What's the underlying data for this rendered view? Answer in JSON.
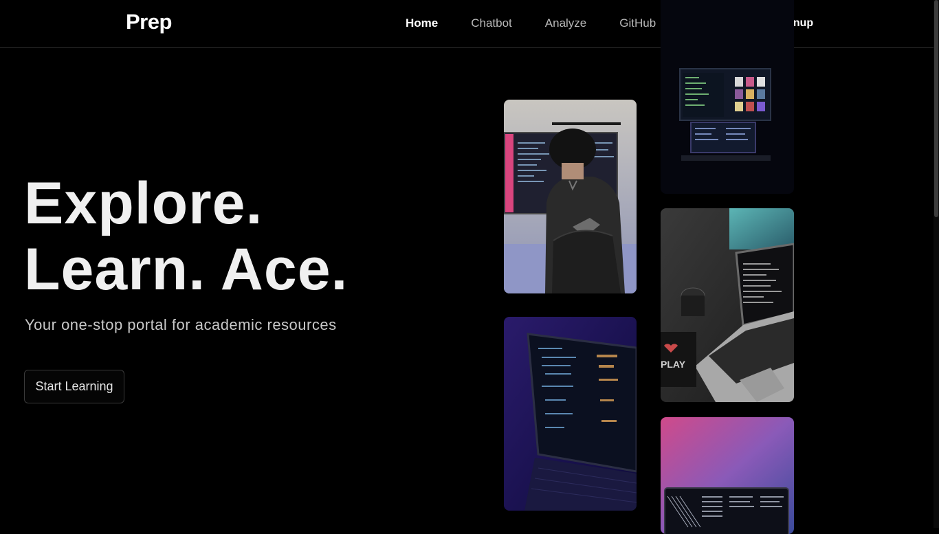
{
  "nav": {
    "brand": "Prep",
    "links": [
      {
        "label": "Home",
        "active": true
      },
      {
        "label": "Chatbot"
      },
      {
        "label": "Analyze"
      },
      {
        "label": "GitHub"
      }
    ],
    "theme_icon": "sun-icon",
    "login": "Login/Signup"
  },
  "hero": {
    "title_line1": "Explore.",
    "title_line2": "Learn. Ace.",
    "subtitle": "Your one-stop portal for academic resources",
    "cta": "Start Learning"
  },
  "gallery": {
    "photos": [
      {
        "name": "person-coding-photo"
      },
      {
        "name": "laptop-code-blue-photo"
      },
      {
        "name": "dual-monitor-photo"
      },
      {
        "name": "laptop-desk-photo"
      },
      {
        "name": "laptop-pink-photo"
      }
    ]
  },
  "colors": {
    "background": "#000000",
    "text": "#f0f0f0",
    "muted": "#b9b9b9"
  }
}
